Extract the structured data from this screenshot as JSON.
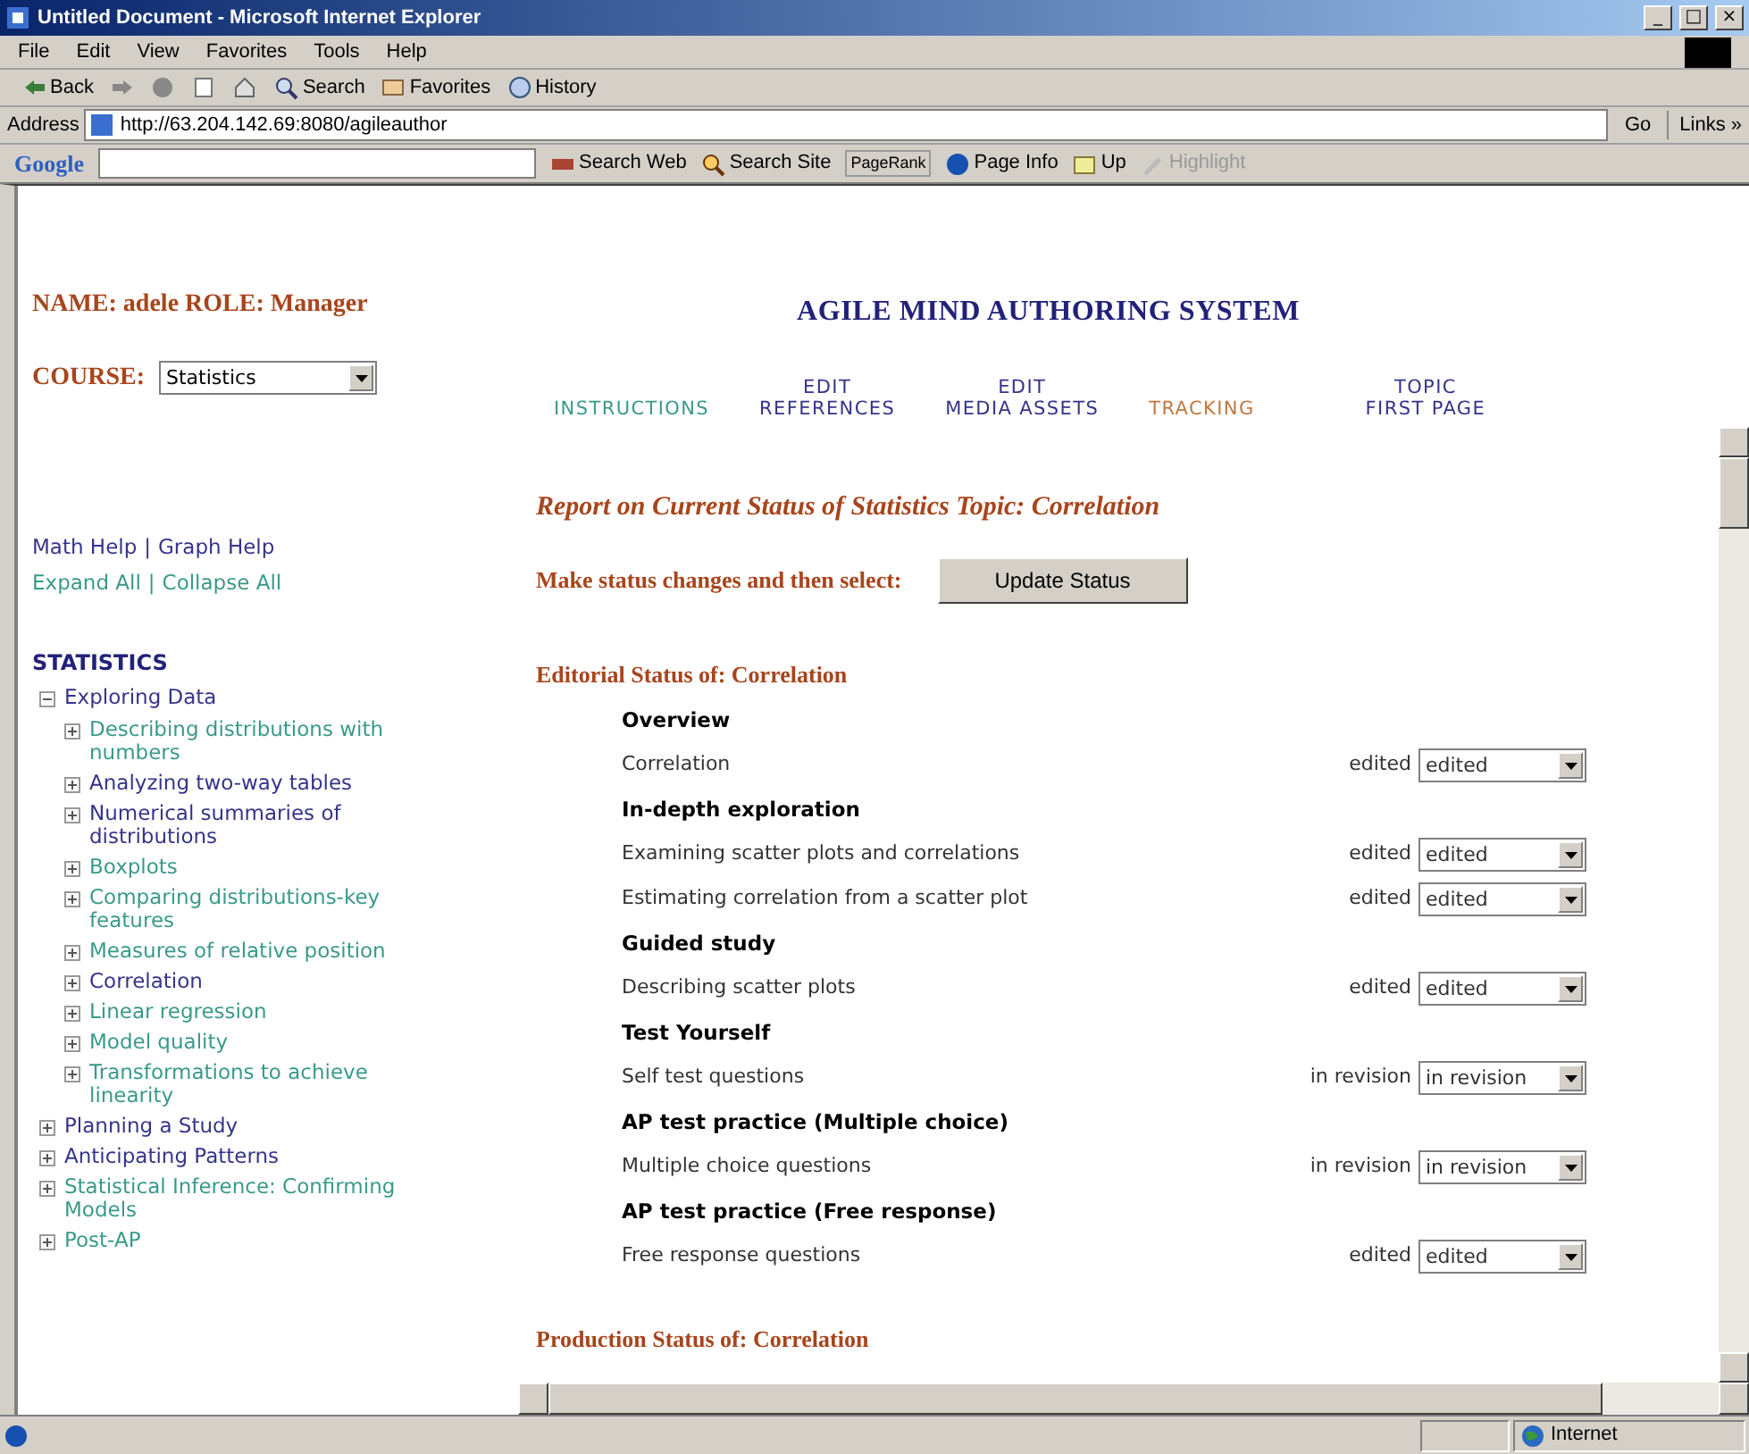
{
  "window": {
    "title": "Untitled Document - Microsoft Internet Explorer",
    "controls": [
      "_",
      "□",
      "×"
    ]
  },
  "menu": [
    "File",
    "Edit",
    "View",
    "Favorites",
    "Tools",
    "Help"
  ],
  "toolbar": {
    "back": "Back",
    "search": "Search",
    "favorites": "Favorites",
    "history": "History"
  },
  "address": {
    "label": "Address",
    "value": "http://63.204.142.69:8080/agileauthor",
    "go": "Go",
    "links": "Links »"
  },
  "google_bar": {
    "logo": "Google",
    "buttons": [
      "Search Web",
      "Search Site",
      "PageRank",
      "Page Info",
      "Up",
      "Highlight"
    ]
  },
  "sidebar": {
    "name_line": "NAME: adele ROLE: Manager",
    "course_label": "COURSE:",
    "course_value": "Statistics",
    "links": [
      {
        "separator": "|",
        "items": [
          {
            "label": "Math Help",
            "visited": false
          },
          {
            "label": "Graph Help",
            "visited": false
          }
        ]
      },
      {
        "separator": "|",
        "items": [
          {
            "label": "Expand All",
            "visited": true
          },
          {
            "label": "Collapse All",
            "visited": true
          }
        ]
      }
    ],
    "tree_title": "STATISTICS",
    "tree": [
      {
        "label": "Exploring Data",
        "expanded": true,
        "visited": false,
        "children": [
          {
            "label": "Describing distributions with numbers",
            "expanded": false,
            "visited": true
          },
          {
            "label": "Analyzing two-way tables",
            "expanded": false,
            "visited": false
          },
          {
            "label": "Numerical summaries of distributions",
            "expanded": false,
            "visited": false
          },
          {
            "label": "Boxplots",
            "expanded": false,
            "visited": true
          },
          {
            "label": "Comparing distributions-key features",
            "expanded": false,
            "visited": true
          },
          {
            "label": "Measures of relative position",
            "expanded": false,
            "visited": true
          },
          {
            "label": "Correlation",
            "expanded": false,
            "visited": false
          },
          {
            "label": "Linear regression",
            "expanded": false,
            "visited": true
          },
          {
            "label": "Model quality",
            "expanded": false,
            "visited": true
          },
          {
            "label": "Transformations to achieve linearity",
            "expanded": false,
            "visited": true
          }
        ]
      },
      {
        "label": "Planning a Study",
        "expanded": false,
        "visited": false
      },
      {
        "label": "Anticipating Patterns",
        "expanded": false,
        "visited": false
      },
      {
        "label": "Statistical Inference: Confirming Models",
        "expanded": false,
        "visited": true
      },
      {
        "label": "Post-AP",
        "expanded": false,
        "visited": true
      }
    ]
  },
  "header": {
    "title": "AGILE MIND AUTHORING SYSTEM"
  },
  "nav": [
    {
      "lines": [
        "INSTRUCTIONS"
      ],
      "selected": false,
      "visited": true
    },
    {
      "lines": [
        "EDIT",
        "REFERENCES"
      ],
      "selected": false,
      "visited": false
    },
    {
      "lines": [
        "EDIT",
        "MEDIA ASSETS"
      ],
      "selected": false,
      "visited": false
    },
    {
      "lines": [
        "TRACKING"
      ],
      "selected": true
    },
    {
      "lines": [
        "TOPIC",
        "FIRST PAGE"
      ],
      "selected": false,
      "visited": false
    }
  ],
  "report": {
    "title": "Report on Current Status of Statistics Topic: Correlation",
    "prompt": "Make status changes and then select:",
    "button": "Update Status",
    "editorial_title": "Editorial Status of: Correlation",
    "sections": [
      {
        "heading": "Overview",
        "items": [
          {
            "label": "Correlation",
            "status": "edited",
            "value": "edited"
          }
        ]
      },
      {
        "heading": "In-depth exploration",
        "items": [
          {
            "label": "Examining scatter plots and correlations",
            "status": "edited",
            "value": "edited"
          },
          {
            "label": "Estimating correlation from a scatter plot",
            "status": "edited",
            "value": "edited"
          }
        ]
      },
      {
        "heading": "Guided study",
        "items": [
          {
            "label": "Describing scatter plots",
            "status": "edited",
            "value": "edited"
          }
        ]
      },
      {
        "heading": "Test Yourself",
        "items": [
          {
            "label": "Self test questions",
            "status": "in revision",
            "value": "in revision"
          }
        ]
      },
      {
        "heading": "AP test practice (Multiple choice)",
        "items": [
          {
            "label": "Multiple choice questions",
            "status": "in revision",
            "value": "in revision"
          }
        ]
      },
      {
        "heading": "AP test practice (Free response)",
        "items": [
          {
            "label": "Free response questions",
            "status": "edited",
            "value": "edited"
          }
        ]
      }
    ],
    "production_title": "Production Status of: Correlation"
  },
  "status_bar": {
    "zone": "Internet"
  }
}
